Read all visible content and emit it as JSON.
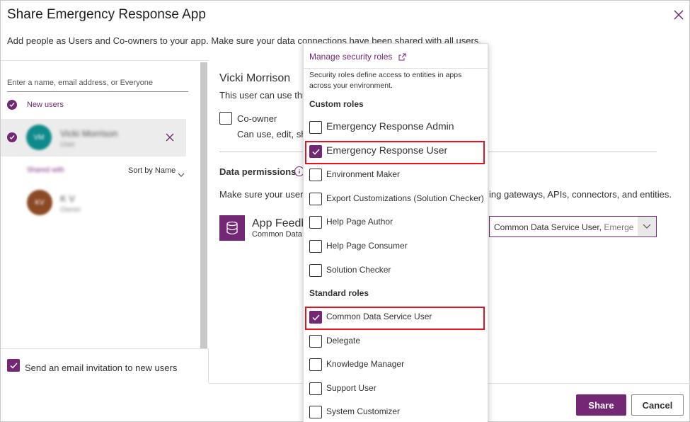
{
  "dialog": {
    "title": "Share Emergency Response App",
    "subtitle": "Add people as Users and Co-owners to your app. Make sure your data connections have been shared with all users."
  },
  "left_panel": {
    "search_placeholder": "Enter a name, email address, or Everyone",
    "new_users_label": "New users",
    "new_user": {
      "initials": "VM",
      "name": "Vicki Morrison",
      "role": "User"
    },
    "shared_with_label": "Shared with",
    "sort_label": "Sort by Name",
    "owner": {
      "initials": "KV",
      "name": "K V",
      "role": "Owner"
    },
    "email_invite_label": "Send an email invitation to new users",
    "email_invite_checked": true
  },
  "right_panel": {
    "user_name": "Vicki Morrison",
    "user_can_use": "This user can use this",
    "coowner_label": "Co-owner",
    "coowner_desc": "Can use, edit, sha",
    "data_permissions_title": "Data permissions",
    "data_permissions_desc": "Make sure your users",
    "data_permissions_desc_end": "ing gateways, APIs, connectors, and entities.",
    "app_name": "App Feedb",
    "app_source": "Common Data S",
    "role_select_value": "Common Data Service User,",
    "role_select_more": "Emerge"
  },
  "dropdown": {
    "manage_link": "Manage security roles",
    "description": "Security roles define access to entities in apps across your environment.",
    "custom_roles_title": "Custom roles",
    "custom_roles": [
      {
        "label": "Emergency Response Admin",
        "checked": false
      },
      {
        "label": "Emergency Response User",
        "checked": true
      },
      {
        "label": "Environment Maker",
        "checked": false
      },
      {
        "label": "Export Customizations (Solution Checker)",
        "checked": false
      },
      {
        "label": "Help Page Author",
        "checked": false
      },
      {
        "label": "Help Page Consumer",
        "checked": false
      },
      {
        "label": "Solution Checker",
        "checked": false
      }
    ],
    "standard_roles_title": "Standard roles",
    "standard_roles": [
      {
        "label": "Common Data Service User",
        "checked": true
      },
      {
        "label": "Delegate",
        "checked": false
      },
      {
        "label": "Knowledge Manager",
        "checked": false
      },
      {
        "label": "Support User",
        "checked": false
      },
      {
        "label": "System Customizer",
        "checked": false
      }
    ]
  },
  "footer": {
    "share_label": "Share",
    "cancel_label": "Cancel"
  },
  "colors": {
    "accent": "#742774",
    "highlight": "#e8101c",
    "avatar_new_user": "#0f8a8a",
    "avatar_owner": "#8b4a24"
  }
}
